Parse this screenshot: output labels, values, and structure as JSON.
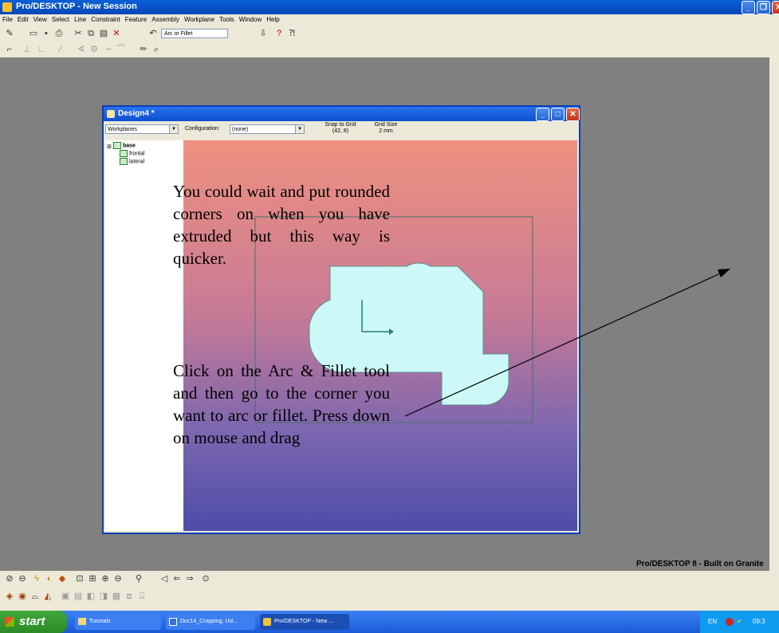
{
  "app": {
    "title": "Pro/DESKTOP - New Session",
    "status_text": "Pro/DESKTOP 8 - Built on Granite"
  },
  "menu": [
    "File",
    "Edit",
    "View",
    "Select",
    "Line",
    "Constraint",
    "Feature",
    "Assembly",
    "Workplane",
    "Tools",
    "Window",
    "Help"
  ],
  "toolbar": {
    "arc_combo_value": "Arc or Fillet"
  },
  "design_window": {
    "title": "Design4 *",
    "workplanes_select": "Workplanes",
    "configuration_label": "Configuration:",
    "configuration_value": "(none)",
    "snap_label": "Snap to Grid",
    "snap_value": "(42, 8)",
    "grid_label": "Grid Size",
    "grid_value": "2 mm",
    "tree": [
      "base",
      "frontal",
      "lateral"
    ]
  },
  "overlay": {
    "para1": "You could wait and put rounded corners on when you have extruded but this way is quicker.",
    "para2": "Click on the Arc & Fillet tool and then go to the corner you want to arc or fillet. Press down on mouse and drag"
  },
  "taskbar": {
    "start": "start",
    "tasks": [
      "Tutorials",
      "Doc14_Cropping, Usi...",
      "Pro/DESKTOP - New ..."
    ],
    "tray_lang": "EN",
    "tray_time": "09:3"
  },
  "colors": {
    "titlebar": "#0a5fd6",
    "shape_fill": "#ccf9f8",
    "viewport_top": "#f09180",
    "viewport_bottom": "#4d4ca8"
  }
}
